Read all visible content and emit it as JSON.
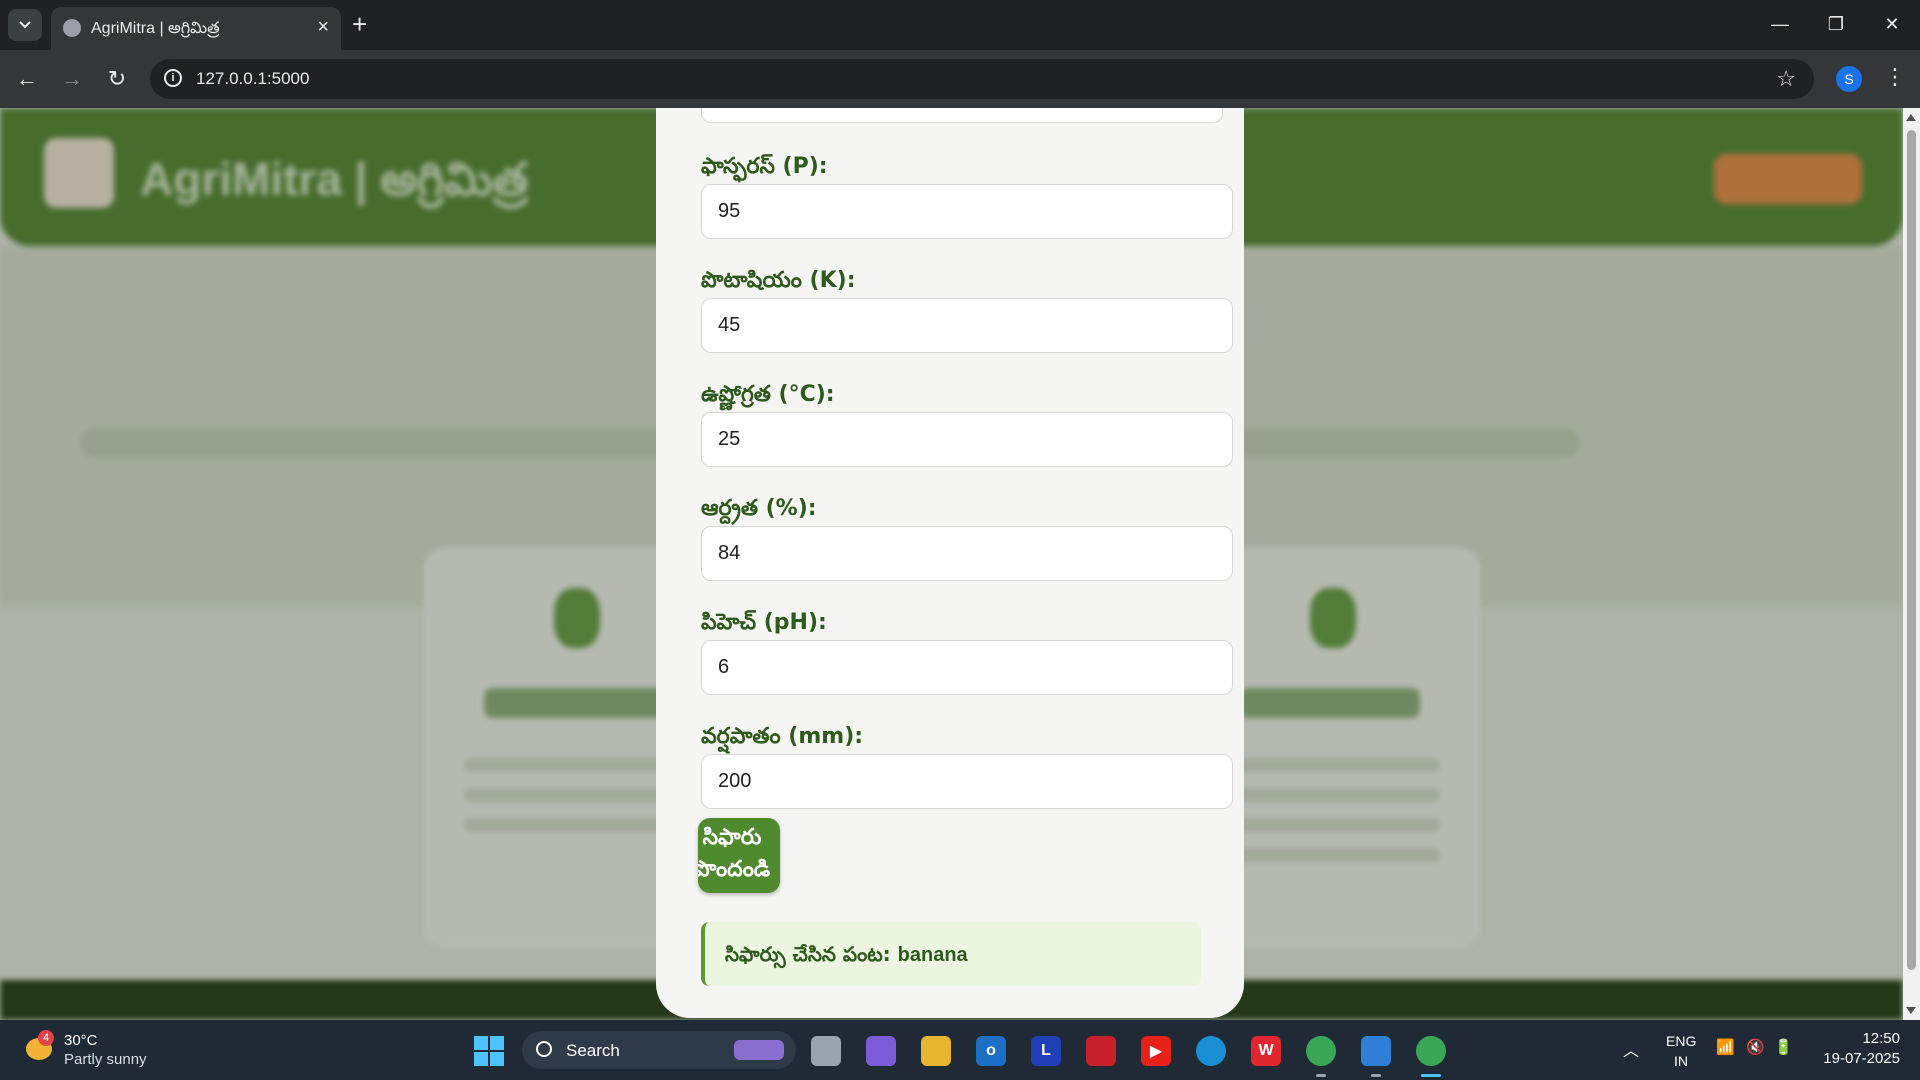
{
  "browser": {
    "tab_title": "AgriMitra | అగ్రిమిత్ర",
    "url": "127.0.0.1:5000",
    "profile_initial": "S"
  },
  "background_page": {
    "site_name": "AgriMitra | అగ్రిమిత్ర"
  },
  "form": {
    "fields": [
      {
        "label": "ఫాస్ఫరస్ (P):",
        "value": "95"
      },
      {
        "label": "పొటాషియం (K):",
        "value": "45"
      },
      {
        "label": "ఉష్ణోగ్రత (°C):",
        "value": "25"
      },
      {
        "label": "ఆర్ద్రత (%):",
        "value": "84"
      },
      {
        "label": "పిహెచ్ (pH):",
        "value": "6"
      },
      {
        "label": "వర్షపాతం (mm):",
        "value": "200"
      }
    ],
    "submit_line1": "సిఫారు",
    "submit_line2": "పొందండి",
    "result_prefix": "సిఫార్సు చేసిన పంట: ",
    "result_crop": "banana"
  },
  "taskbar": {
    "weather_temp": "30°C",
    "weather_condition": "Partly sunny",
    "weather_badge": "4",
    "search_label": "Search",
    "language": "ENG",
    "region": "IN",
    "time": "12:50",
    "date": "19-07-2025"
  },
  "colors": {
    "accent_green": "#4f8a2e",
    "label_green": "#2f5a1d",
    "result_bg": "#ebf5df"
  }
}
